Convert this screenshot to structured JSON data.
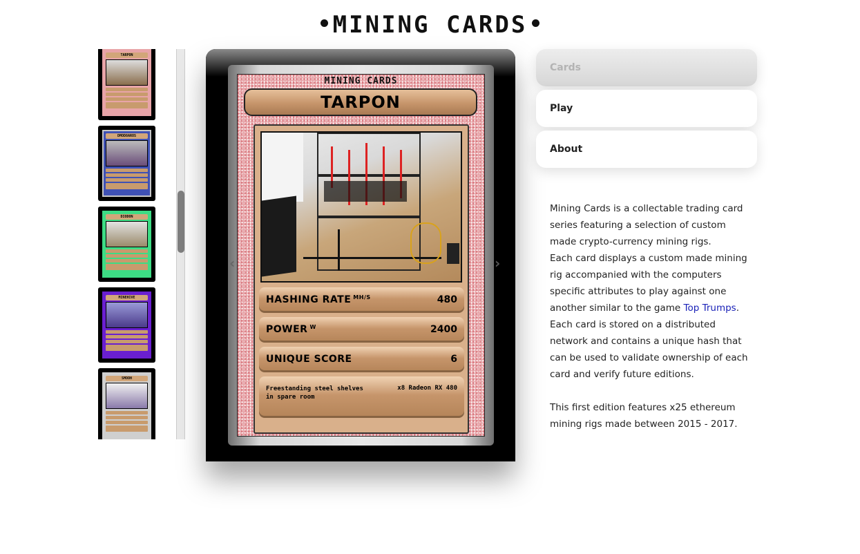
{
  "site": {
    "title": "MINING CARDS"
  },
  "thumbnails": [
    {
      "name": "TARPON",
      "frame_color": "#e8a4a8"
    },
    {
      "name": "DMOD8AROS",
      "frame_color": "#3f51b5"
    },
    {
      "name": "DIODON",
      "frame_color": "#3ddc84"
    },
    {
      "name": "MINEHIVE",
      "frame_color": "#6a1fd0"
    },
    {
      "name": "SMOOH",
      "frame_color": "#cfcfcf"
    }
  ],
  "card": {
    "series": "MINING CARDS",
    "name": "TARPON",
    "stats": [
      {
        "label": "HASHING RATE",
        "unit": "MH/S",
        "value": "480"
      },
      {
        "label": "POWER",
        "unit": "W",
        "value": "2400"
      },
      {
        "label": "UNIQUE SCORE",
        "unit": "",
        "value": "6"
      }
    ],
    "description_left": "Freestanding steel shelves in spare room",
    "description_right": "x8 Radeon RX 480"
  },
  "menu": {
    "items": [
      {
        "label": "Cards",
        "active": true
      },
      {
        "label": "Play",
        "active": false
      },
      {
        "label": "About",
        "active": false
      }
    ]
  },
  "about": {
    "p1": "Mining Cards is a collectable trading card series featuring a selection of custom made crypto-currency mining rigs.",
    "p2_before": "Each card displays a custom made mining rig accompanied with the computers specific attributes to play against one another similar to the game ",
    "p2_link": "Top Trumps",
    "p2_after": ".",
    "p3": "Each card is stored on a distributed network and contains a unique hash that can be used to validate ownership of each card and verify future editions.",
    "p4": "This first edition features x25 ethereum mining rigs made between 2015 - 2017."
  },
  "colors": {
    "accent_link": "#1a22b8",
    "card_bar": "#c6956b",
    "card_border": "#e6a2a6"
  }
}
